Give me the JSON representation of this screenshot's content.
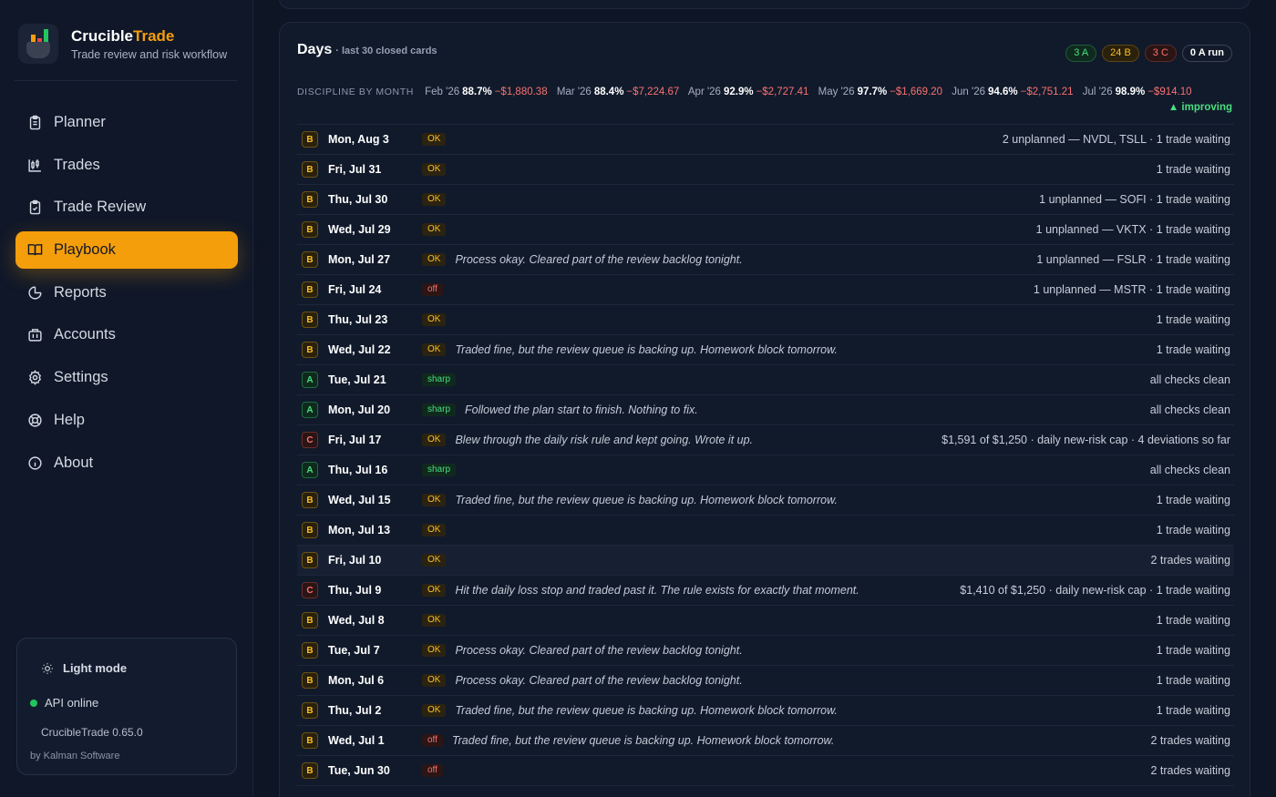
{
  "brand": {
    "name_main": "Crucible",
    "name_accent": "Trade",
    "subtitle": "Trade review and risk workflow"
  },
  "nav": [
    {
      "label": "Planner",
      "icon": "clipboard-icon",
      "active": false
    },
    {
      "label": "Trades",
      "icon": "candlestick-icon",
      "active": false
    },
    {
      "label": "Trade Review",
      "icon": "clipboard-check-icon",
      "active": false
    },
    {
      "label": "Playbook",
      "icon": "book-open-icon",
      "active": true
    },
    {
      "label": "Reports",
      "icon": "pie-chart-icon",
      "active": false
    },
    {
      "label": "Accounts",
      "icon": "building-icon",
      "active": false
    },
    {
      "label": "Settings",
      "icon": "gear-icon",
      "active": false
    },
    {
      "label": "Help",
      "icon": "lifebuoy-icon",
      "active": false
    },
    {
      "label": "About",
      "icon": "info-icon",
      "active": false
    }
  ],
  "footer": {
    "light_mode": "Light mode",
    "api_status": "API online",
    "version": "CrucibleTrade 0.65.0",
    "byline": "by Kalman Software"
  },
  "days": {
    "title": "Days",
    "subtitle": "· last 30 closed cards",
    "chips": {
      "a": "3 A",
      "b": "24 B",
      "c": "3 C",
      "run": "0 A run"
    },
    "discipline_label": "DISCIPLINE BY MONTH",
    "months": [
      {
        "month": "Feb '26",
        "pct": "88.7%",
        "pnl": "−$1,880.38"
      },
      {
        "month": "Mar '26",
        "pct": "88.4%",
        "pnl": "−$7,224.67"
      },
      {
        "month": "Apr '26",
        "pct": "92.9%",
        "pnl": "−$2,727.41"
      },
      {
        "month": "May '26",
        "pct": "97.7%",
        "pnl": "−$1,669.20"
      },
      {
        "month": "Jun '26",
        "pct": "94.6%",
        "pnl": "−$2,751.21"
      },
      {
        "month": "Jul '26",
        "pct": "98.9%",
        "pnl": "−$914.10"
      }
    ],
    "trend": "▲ improving",
    "rows": [
      {
        "grade": "B",
        "date": "Mon, Aug 3",
        "tag": "OK",
        "note": "",
        "status": "2 unplanned — NVDL, TSLL · 1 trade waiting"
      },
      {
        "grade": "B",
        "date": "Fri, Jul 31",
        "tag": "OK",
        "note": "",
        "status": "1 trade waiting"
      },
      {
        "grade": "B",
        "date": "Thu, Jul 30",
        "tag": "OK",
        "note": "",
        "status": "1 unplanned — SOFI · 1 trade waiting"
      },
      {
        "grade": "B",
        "date": "Wed, Jul 29",
        "tag": "OK",
        "note": "",
        "status": "1 unplanned — VKTX · 1 trade waiting"
      },
      {
        "grade": "B",
        "date": "Mon, Jul 27",
        "tag": "OK",
        "note": "Process okay. Cleared part of the review backlog tonight.",
        "status": "1 unplanned — FSLR · 1 trade waiting"
      },
      {
        "grade": "B",
        "date": "Fri, Jul 24",
        "tag": "off",
        "note": "",
        "status": "1 unplanned — MSTR · 1 trade waiting"
      },
      {
        "grade": "B",
        "date": "Thu, Jul 23",
        "tag": "OK",
        "note": "",
        "status": "1 trade waiting"
      },
      {
        "grade": "B",
        "date": "Wed, Jul 22",
        "tag": "OK",
        "note": "Traded fine, but the review queue is backing up. Homework block tomorrow.",
        "status": "1 trade waiting"
      },
      {
        "grade": "A",
        "date": "Tue, Jul 21",
        "tag": "sharp",
        "note": "",
        "status": "all checks clean"
      },
      {
        "grade": "A",
        "date": "Mon, Jul 20",
        "tag": "sharp",
        "note": "Followed the plan start to finish. Nothing to fix.",
        "status": "all checks clean"
      },
      {
        "grade": "C",
        "date": "Fri, Jul 17",
        "tag": "OK",
        "note": "Blew through the daily risk rule and kept going. Wrote it up.",
        "status": "$1,591 of $1,250 · daily new-risk cap · 4 deviations so far"
      },
      {
        "grade": "A",
        "date": "Thu, Jul 16",
        "tag": "sharp",
        "note": "",
        "status": "all checks clean"
      },
      {
        "grade": "B",
        "date": "Wed, Jul 15",
        "tag": "OK",
        "note": "Traded fine, but the review queue is backing up. Homework block tomorrow.",
        "status": "1 trade waiting"
      },
      {
        "grade": "B",
        "date": "Mon, Jul 13",
        "tag": "OK",
        "note": "",
        "status": "1 trade waiting"
      },
      {
        "grade": "B",
        "date": "Fri, Jul 10",
        "tag": "OK",
        "note": "",
        "status": "2 trades waiting",
        "highlight": true
      },
      {
        "grade": "C",
        "date": "Thu, Jul 9",
        "tag": "OK",
        "note": "Hit the daily loss stop and traded past it. The rule exists for exactly that moment.",
        "status": "$1,410 of $1,250 · daily new-risk cap · 1 trade waiting"
      },
      {
        "grade": "B",
        "date": "Wed, Jul 8",
        "tag": "OK",
        "note": "",
        "status": "1 trade waiting"
      },
      {
        "grade": "B",
        "date": "Tue, Jul 7",
        "tag": "OK",
        "note": "Process okay. Cleared part of the review backlog tonight.",
        "status": "1 trade waiting"
      },
      {
        "grade": "B",
        "date": "Mon, Jul 6",
        "tag": "OK",
        "note": "Process okay. Cleared part of the review backlog tonight.",
        "status": "1 trade waiting"
      },
      {
        "grade": "B",
        "date": "Thu, Jul 2",
        "tag": "OK",
        "note": "Traded fine, but the review queue is backing up. Homework block tomorrow.",
        "status": "1 trade waiting"
      },
      {
        "grade": "B",
        "date": "Wed, Jul 1",
        "tag": "off",
        "note": "Traded fine, but the review queue is backing up. Homework block tomorrow.",
        "status": "2 trades waiting"
      },
      {
        "grade": "B",
        "date": "Tue, Jun 30",
        "tag": "off",
        "note": "",
        "status": "2 trades waiting"
      }
    ]
  },
  "colors": {
    "accent": "#f59e0b",
    "background": "#0e1525",
    "panel": "#111a2b",
    "grade_a": "#4ade80",
    "grade_b": "#fbbf24",
    "grade_c": "#f87171"
  }
}
